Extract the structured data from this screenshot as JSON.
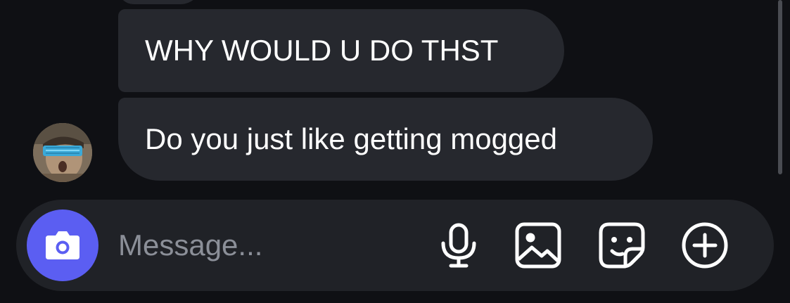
{
  "conversation": {
    "messages": [
      {
        "sender": "other",
        "text": "WHY WOULD U DO THST"
      },
      {
        "sender": "other",
        "text": "Do you just like getting mogged"
      }
    ]
  },
  "composer": {
    "placeholder": "Message...",
    "actions": [
      "camera-icon",
      "microphone-icon",
      "image-icon",
      "sticker-icon",
      "plus-circle-icon"
    ]
  },
  "colors": {
    "background": "#0f1014",
    "bubble": "#26282e",
    "composer": "#202227",
    "accent": "#5b5ef2",
    "placeholder": "#8b8f98"
  }
}
